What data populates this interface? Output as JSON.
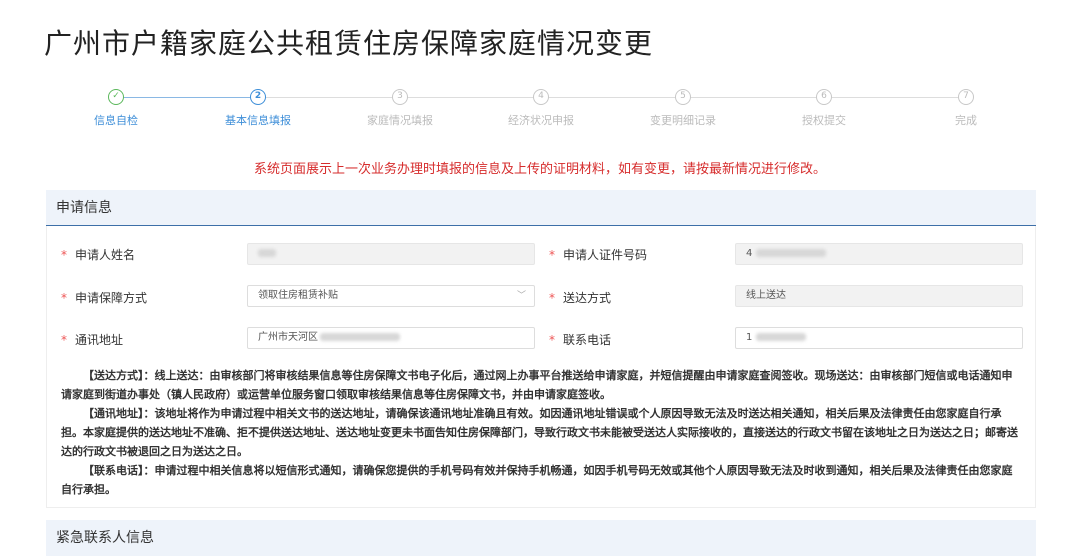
{
  "page": {
    "title": "广州市户籍家庭公共租赁住房保障家庭情况变更"
  },
  "steps": [
    {
      "num": "✓",
      "label": "信息自检",
      "state": "done"
    },
    {
      "num": "2",
      "label": "基本信息填报",
      "state": "active"
    },
    {
      "num": "3",
      "label": "家庭情况填报",
      "state": "pending"
    },
    {
      "num": "4",
      "label": "经济状况申报",
      "state": "pending"
    },
    {
      "num": "5",
      "label": "变更明细记录",
      "state": "pending"
    },
    {
      "num": "6",
      "label": "授权提交",
      "state": "pending"
    },
    {
      "num": "7",
      "label": "完成",
      "state": "pending"
    }
  ],
  "notice": "系统页面展示上一次业务办理时填报的信息及上传的证明材料，如有变更，请按最新情况进行修改。",
  "section1": {
    "title": "申请信息",
    "required_mark": "*",
    "fields": {
      "name_label": "申请人姓名",
      "id_label": "申请人证件号码",
      "id_value": "4",
      "method_label": "申请保障方式",
      "method_value": "领取住房租赁补贴",
      "delivery_label": "送达方式",
      "delivery_value": "线上送达",
      "address_label": "通讯地址",
      "address_value": "广州市天河区",
      "phone_label": "联系电话",
      "phone_value": "1"
    },
    "desc": {
      "p1": "【送达方式】：线上送达：由审核部门将审核结果信息等住房保障文书电子化后，通过网上办事平台推送给申请家庭，并短信提醒由申请家庭查阅签收。现场送达：由审核部门短信或电话通知申请家庭到街道办事处（镇人民政府）或运营单位服务窗口领取审核结果信息等住房保障文书，并由申请家庭签收。",
      "p2": "【通讯地址】：该地址将作为申请过程中相关文书的送达地址，请确保该通讯地址准确且有效。如因通讯地址错误或个人原因导致无法及时送达相关通知，相关后果及法律责任由您家庭自行承担。本家庭提供的送达地址不准确、拒不提供送达地址、送达地址变更未书面告知住房保障部门，导致行政文书未能被受送达人实际接收的，直接送达的行政文书留在该地址之日为送达之日；邮寄送达的行政文书被退回之日为送达之日。",
      "p3": "【联系电话】：申请过程中相关信息将以短信形式通知，请确保您提供的手机号码有效并保持手机畅通，如因手机号码无效或其他个人原因导致无法及时收到通知，相关后果及法律责任由您家庭自行承担。"
    }
  },
  "section2": {
    "title": "紧急联系人信息"
  },
  "icons": {
    "select_arrow": "chevron-down-icon"
  },
  "colors": {
    "primary": "#3d8ed8",
    "success": "#5cb85c",
    "notice": "#d62c2c",
    "required": "#e55555",
    "panel_header_bg": "#eef3fa"
  }
}
